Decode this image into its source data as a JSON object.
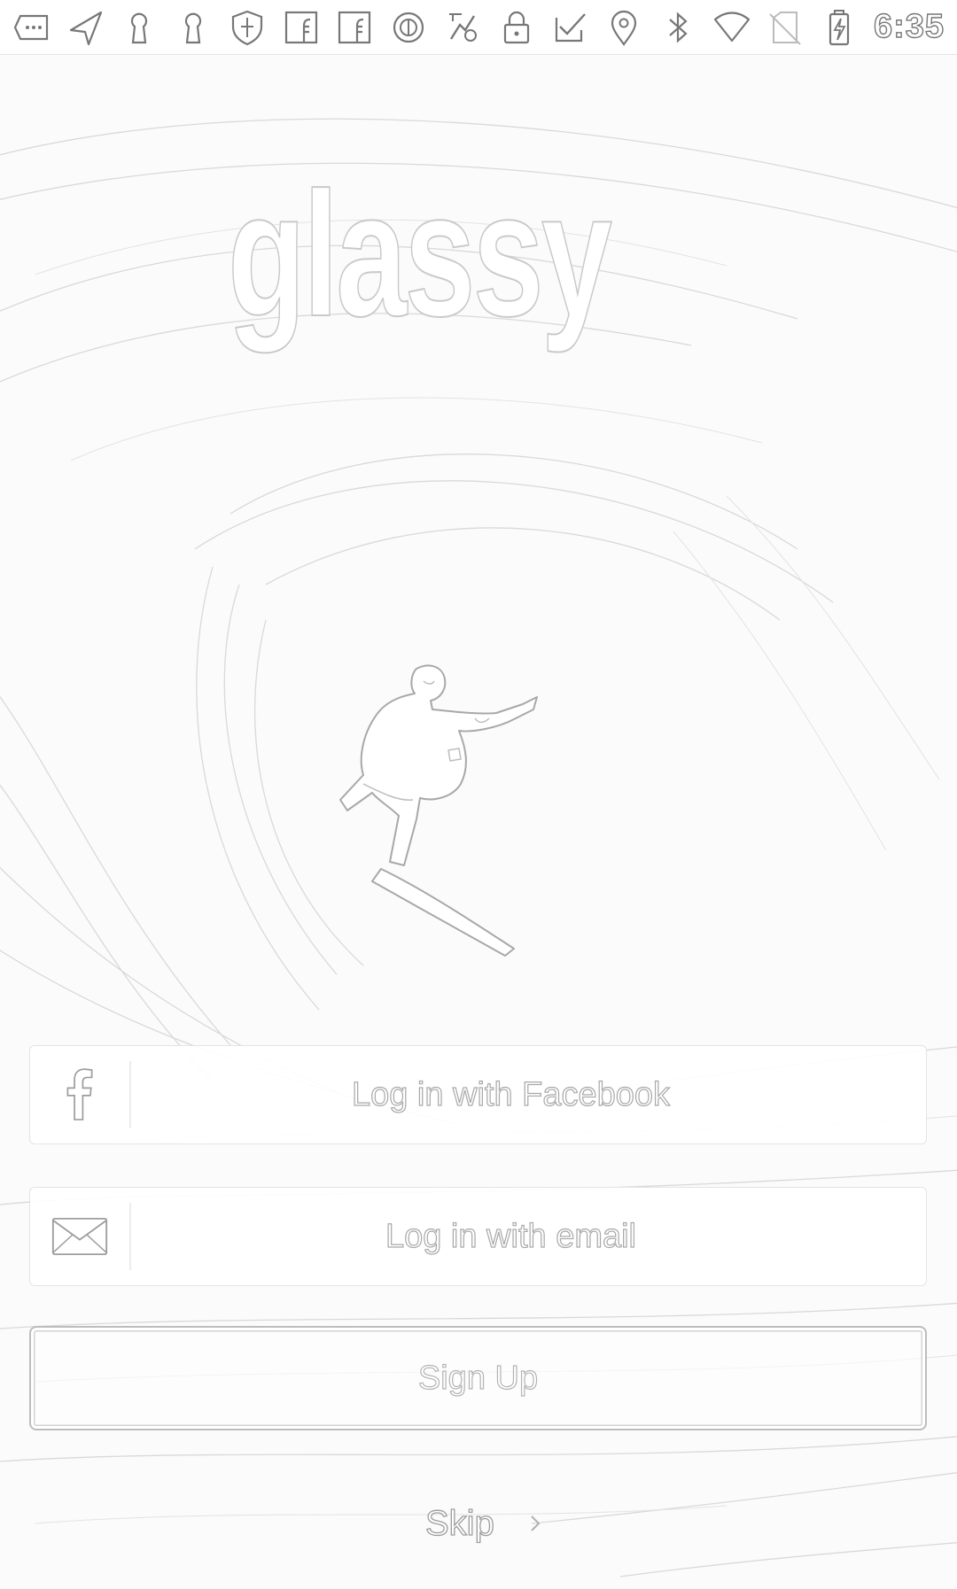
{
  "status_bar": {
    "time": "6:35",
    "icons": [
      "more-notifications-icon",
      "send-icon",
      "keyhole-icon",
      "keyhole-icon",
      "shield-icon",
      "facebook-notification-icon",
      "facebook-notification-icon",
      "circle-status-icon",
      "app-notification-icon",
      "lock-icon",
      "checklist-icon",
      "location-icon",
      "bluetooth-icon",
      "wifi-icon",
      "no-sim-icon",
      "battery-charging-icon"
    ]
  },
  "brand": {
    "name": "glassy"
  },
  "actions": {
    "facebook_label": "Log in with Facebook",
    "email_label": "Log in with email",
    "signup_label": "Sign Up",
    "skip_label": "Skip"
  },
  "colors": {
    "background": "#fbfbfb",
    "outline": "#a8a8a8",
    "button_border": "#e4e4e4"
  }
}
